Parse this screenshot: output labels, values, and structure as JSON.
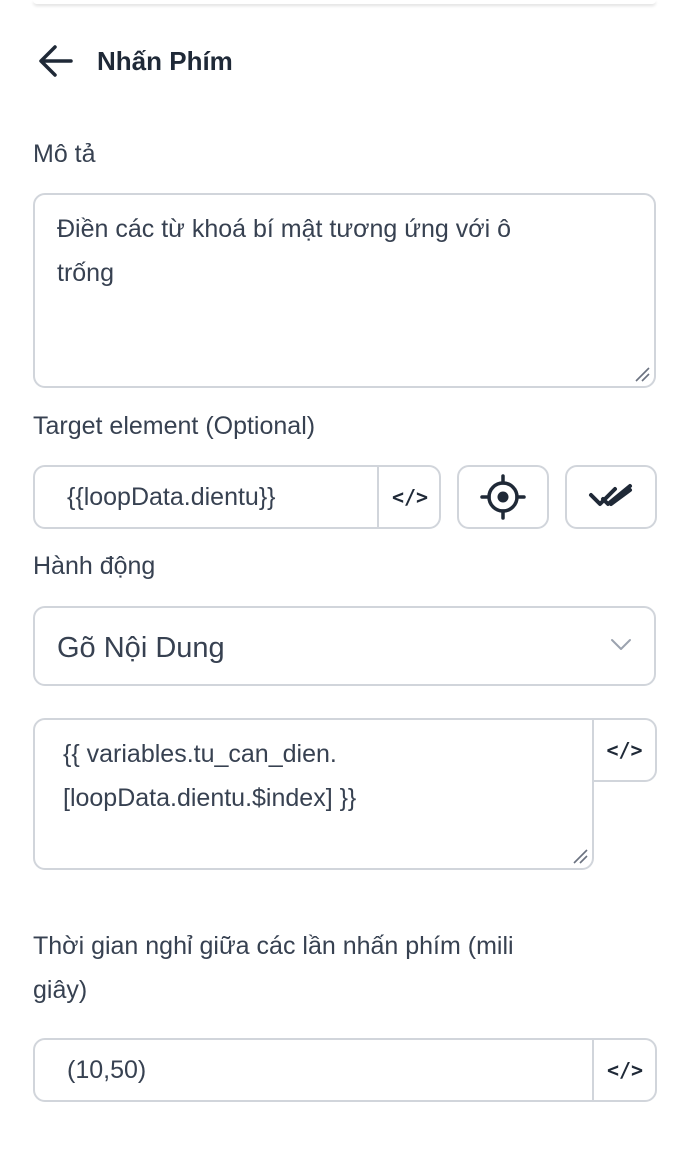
{
  "header": {
    "title": "Nhấn Phím",
    "back_icon": "arrow-left-icon"
  },
  "description": {
    "label": "Mô tả",
    "value": "Điền các từ khoá bí mật tương ứng với ô\ntrống"
  },
  "target_element": {
    "label": "Target element (Optional)",
    "value": "{{loopData.dientu}}",
    "code_toggle": "</>",
    "select_icon": "crosshair-icon",
    "verify_icon": "double-check-icon"
  },
  "action": {
    "label": "Hành động",
    "selected": "Gõ Nội Dung",
    "dropdown_icon": "chevron-down-icon"
  },
  "text_input": {
    "value": "{{ variables.tu_can_dien.\n[loopData.dientu.$index] }}",
    "code_toggle": "</>"
  },
  "delay": {
    "label": "Thời gian nghỉ giữa các lần nhấn phím (mili\ngiây)",
    "value": "(10,50)",
    "code_toggle": "</>"
  }
}
